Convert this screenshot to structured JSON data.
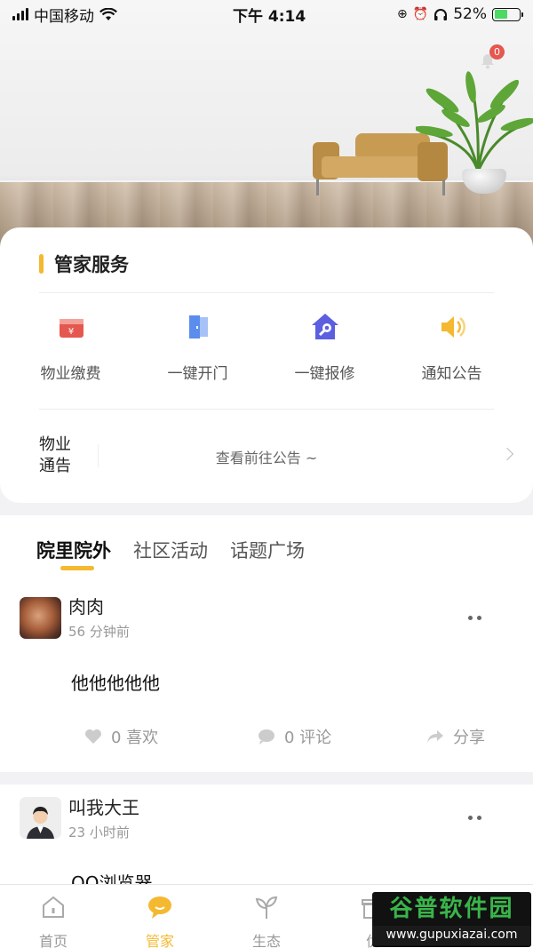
{
  "status_bar": {
    "carrier": "中国移动",
    "time": "下午 4:14",
    "battery": "52%"
  },
  "notification_count": "0",
  "services": {
    "title": "管家服务",
    "items": [
      {
        "label": "物业缴费",
        "icon": "wallet-icon",
        "color": "#e5584f"
      },
      {
        "label": "一键开门",
        "icon": "door-icon",
        "color": "#5b8def"
      },
      {
        "label": "一键报修",
        "icon": "repair-house-icon",
        "color": "#5b5fe0"
      },
      {
        "label": "通知公告",
        "icon": "speaker-icon",
        "color": "#f4b930"
      }
    ]
  },
  "notice": {
    "label_line1": "物业",
    "label_line2": "通告",
    "text": "查看前往公告 ~"
  },
  "feed_tabs": [
    "院里院外",
    "社区活动",
    "话题广场"
  ],
  "posts": [
    {
      "user": "肉肉",
      "time": "56 分钟前",
      "content": "他他他他他",
      "likes": "0 喜欢",
      "comments": "0 评论",
      "share": "分享"
    },
    {
      "user": "叫我大王",
      "time": "23 小时前",
      "content": "QQ浏览器"
    }
  ],
  "tabbar": [
    {
      "label": "首页",
      "icon": "home-icon"
    },
    {
      "label": "管家",
      "icon": "chat-bubble-icon"
    },
    {
      "label": "生态",
      "icon": "sprout-icon"
    },
    {
      "label": "优",
      "icon": "gift-icon"
    }
  ],
  "watermark": {
    "title": "谷普软件园",
    "url": "www.gupuxiazai.com"
  },
  "colors": {
    "accent": "#f4b930"
  }
}
